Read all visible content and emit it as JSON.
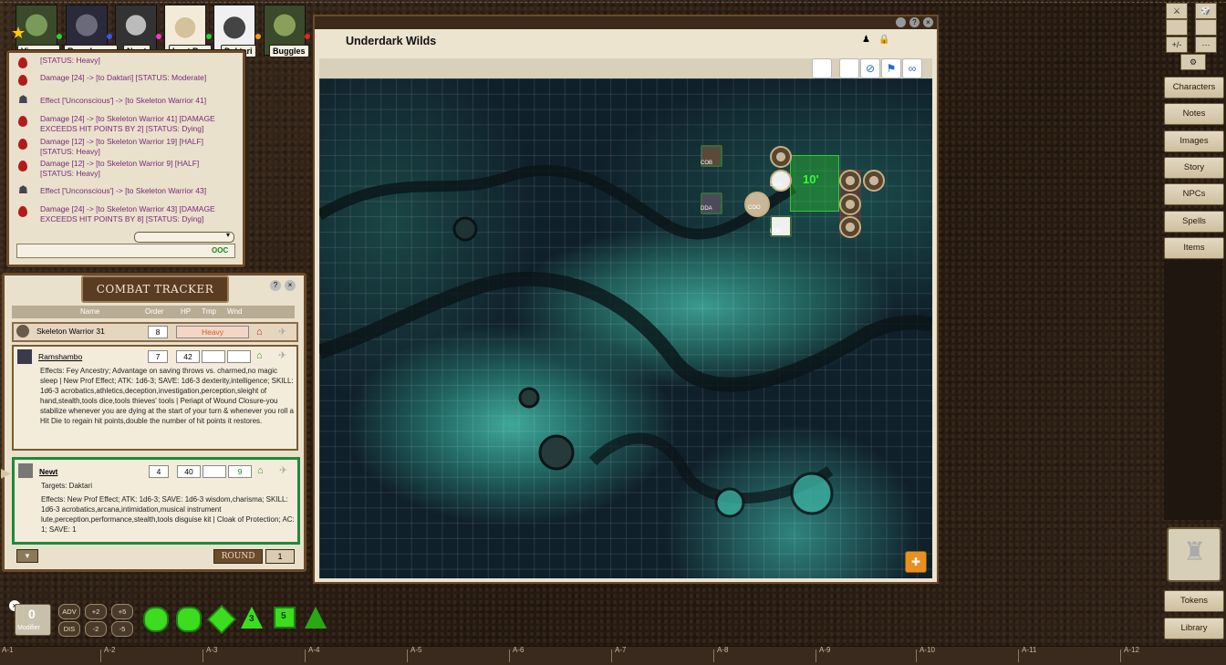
{
  "party": [
    {
      "name": "Vincenzo",
      "dot": "#33cc33"
    },
    {
      "name": "Ramsham...",
      "dot": "#3355ff"
    },
    {
      "name": "Newt",
      "dot": "#ff33cc"
    },
    {
      "name": "Loot Bag",
      "dot": "#33cc33"
    },
    {
      "name": "Daktari",
      "dot": "#ff9922"
    },
    {
      "name": "Buggles",
      "dot": "#ee2222"
    }
  ],
  "chat": {
    "lines": [
      {
        "icon": "drop",
        "text": "[STATUS: Heavy]"
      },
      {
        "icon": "drop",
        "text": "Damage [24] -> [to Daktari] [STATUS: Moderate]"
      },
      {
        "icon": "person",
        "text": "Effect ['Unconscious'] -> [to Skeleton Warrior 41]"
      },
      {
        "icon": "drop",
        "text": "Damage [24] -> [to Skeleton Warrior 41] [DAMAGE EXCEEDS HIT POINTS BY 2] [STATUS: Dying]"
      },
      {
        "icon": "drop",
        "text": "Damage [12] -> [to Skeleton Warrior 19] [HALF] [STATUS: Heavy]"
      },
      {
        "icon": "drop",
        "text": "Damage [12] -> [to Skeleton Warrior 9] [HALF] [STATUS: Heavy]"
      },
      {
        "icon": "person",
        "text": "Effect ['Unconscious'] -> [to Skeleton Warrior 43]"
      },
      {
        "icon": "drop",
        "text": "Damage [24] -> [to Skeleton Warrior 43] [DAMAGE EXCEEDS HIT POINTS BY 8] [STATUS: Dying]"
      }
    ],
    "ooc": "OOC"
  },
  "combat_tracker": {
    "title": "COMBAT TRACKER",
    "headers": {
      "name": "Name",
      "order": "Order",
      "hp": "HP",
      "tmp": "Tmp",
      "wnd": "Wnd"
    },
    "rows": [
      {
        "name": "Skeleton Warrior 31",
        "order": "8",
        "status": "Heavy"
      },
      {
        "name": "Ramshambo",
        "order": "7",
        "hp": "42",
        "tmp": "",
        "wnd": "",
        "effects": "Effects: Fey Ancestry; Advantage on saving throws vs. charmed,no magic sleep | New Prof Effect; ATK: 1d6-3; SAVE: 1d6-3 dexterity,intelligence; SKILL: 1d6-3 acrobatics,athletics,deception,investigation,perception,sleight of hand,stealth,tools dice,tools thieves' tools | Periapt of Wound Closure-you stabilize whenever you are dying at the start of your turn & whenever you roll a Hit Die to regain hit points,double the number of hit points it restores."
      },
      {
        "name": "Newt",
        "order": "4",
        "hp": "40",
        "tmp": "",
        "wnd": "9",
        "targets": "Targets: Daktari",
        "effects": "Effects: New Prof Effect; ATK: 1d6-3; SAVE: 1d6-3 wisdom,charisma; SKILL: 1d6-3 acrobatics,arcana,intimidation,musical instrument lute,perception,performance,stealth,tools disguise kit | Cloak of Protection; AC: 1; SAVE: 1"
      }
    ],
    "round_label": "ROUND",
    "round_value": "1"
  },
  "map": {
    "title": "Underdark Wilds",
    "measure": "10'",
    "token_labels": [
      "COB",
      "DAO",
      "COO",
      "LOO",
      "DDA"
    ]
  },
  "sidebar": {
    "top": [
      "⚔",
      "🎲",
      "+/-",
      "⋯"
    ],
    "buttons": [
      "Characters",
      "Notes",
      "Images",
      "Story",
      "NPCs",
      "Spells",
      "Items"
    ],
    "bottom": [
      "Tokens",
      "Library"
    ]
  },
  "modifier": {
    "value": "0",
    "label": "Modifier"
  },
  "mod_buttons": [
    "ADV",
    "+2",
    "+5",
    "DIS",
    "-2",
    "-5"
  ],
  "dice": [
    "d20",
    "d12",
    "d10",
    "d8",
    "d6",
    "d4"
  ],
  "dice_faces": [
    "",
    "",
    "",
    "3",
    "5",
    ""
  ],
  "bottom_cells": [
    "A-1",
    "A-2",
    "A-3",
    "A-4",
    "A-5",
    "A-6",
    "A-7",
    "A-8",
    "A-9",
    "A-10",
    "A-11",
    "A-12"
  ]
}
